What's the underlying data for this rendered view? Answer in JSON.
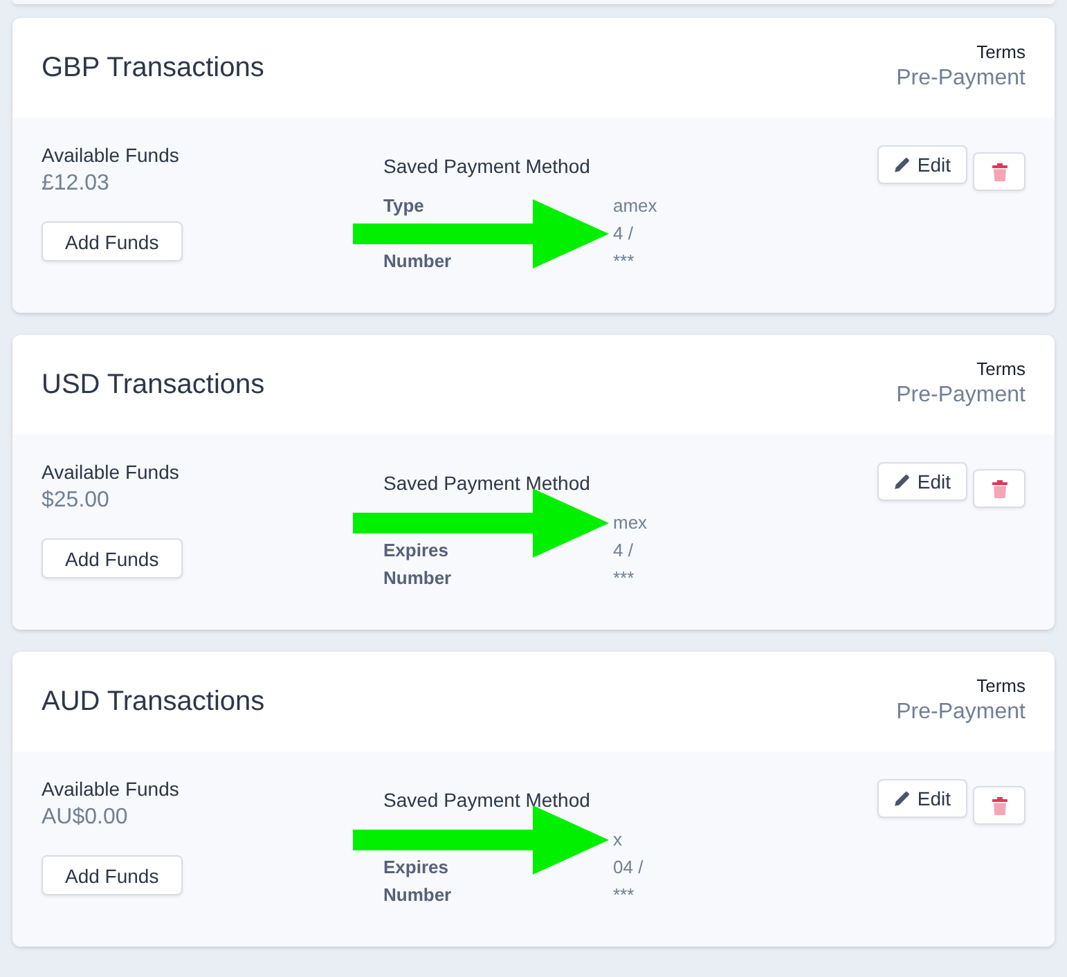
{
  "cards": [
    {
      "title": "GBP Transactions",
      "terms": {
        "label": "Terms",
        "value": "Pre-Payment"
      },
      "funds": {
        "label": "Available Funds",
        "amount": "£12.03",
        "button": "Add Funds"
      },
      "payment_method": {
        "heading": "Saved Payment Method",
        "rows": [
          {
            "label": "Type",
            "value": "amex"
          },
          {
            "value": "4 /"
          },
          {
            "label": "Number",
            "value": "***"
          }
        ]
      },
      "edit_button": "Edit",
      "arrow": true
    },
    {
      "title": "USD Transactions",
      "terms": {
        "label": "Terms",
        "value": "Pre-Payment"
      },
      "funds": {
        "label": "Available Funds",
        "amount": "$25.00",
        "button": "Add Funds"
      },
      "payment_method": {
        "heading": "Saved Payment Method",
        "rows": [
          {
            "value": "mex"
          },
          {
            "label": "Expires",
            "value": "4 /"
          },
          {
            "label": "Number",
            "value": "***"
          }
        ]
      },
      "edit_button": "Edit",
      "arrow": true
    },
    {
      "title": "AUD Transactions",
      "terms": {
        "label": "Terms",
        "value": "Pre-Payment"
      },
      "funds": {
        "label": "Available Funds",
        "amount": "AU$0.00",
        "button": "Add Funds"
      },
      "payment_method": {
        "heading": "Saved Payment Method",
        "rows": [
          {
            "value": "x"
          },
          {
            "label": "Expires",
            "value": "04 /"
          },
          {
            "label": "Number",
            "value": "***"
          }
        ]
      },
      "edit_button": "Edit",
      "arrow": true
    }
  ]
}
